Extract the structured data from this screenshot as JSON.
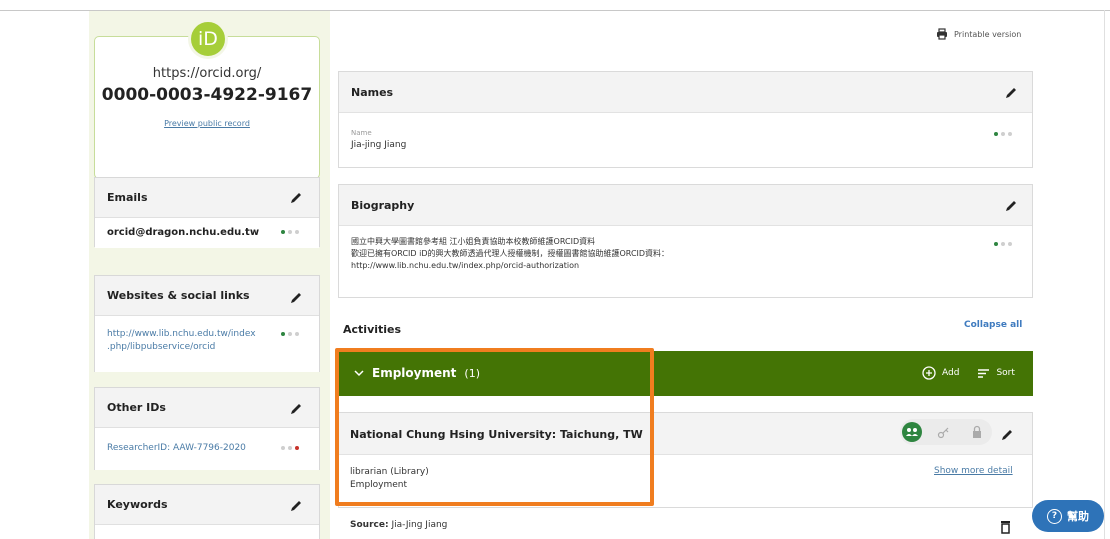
{
  "sidebar": {
    "orcid_logo_text": "iD",
    "orcid_url": "https://orcid.org/",
    "orcid_id": "0000-0003-4922-9167",
    "preview_link": "Preview public record",
    "emails": {
      "title": "Emails",
      "value": "orcid@dragon.nchu.edu.tw"
    },
    "websites": {
      "title": "Websites & social links",
      "line1": "http://www.lib.nchu.edu.tw/index",
      "line2": ".php/libpubservice/orcid"
    },
    "other_ids": {
      "title": "Other IDs",
      "value": "ResearcherID: AAW-7796-2020"
    },
    "keywords": {
      "title": "Keywords"
    }
  },
  "header": {
    "printable": "Printable version"
  },
  "names": {
    "title": "Names",
    "label": "Name",
    "value": "Jia-jing Jiang"
  },
  "biography": {
    "title": "Biography",
    "line1": "國立中興大學圖書館參考組 江小姐負責協助本校教師維護ORCID資料",
    "line2": "歡迎已擁有ORCID iD的興大教師透過代理人授權機制，授權圖書館協助維護ORCID資料：",
    "line3": "http://www.lib.nchu.edu.tw/index.php/orcid-authorization"
  },
  "activities": {
    "title": "Activities",
    "collapse": "Collapse all"
  },
  "employment": {
    "title": "Employment",
    "count": "(1)",
    "add_label": "Add",
    "sort_label": "Sort",
    "org": "National Chung Hsing University: Taichung, TW",
    "role": "librarian (Library)",
    "type": "Employment",
    "show_more": "Show more detail",
    "source_label": "Source:",
    "source_value": "Jia-Jing Jiang"
  },
  "help": {
    "label": "幫助"
  },
  "colors": {
    "orcid_green": "#a6ce39",
    "employment_bar": "#447405",
    "highlight": "#f07d1f",
    "link": "#4a7ba6",
    "help_button": "#2e73b8"
  }
}
